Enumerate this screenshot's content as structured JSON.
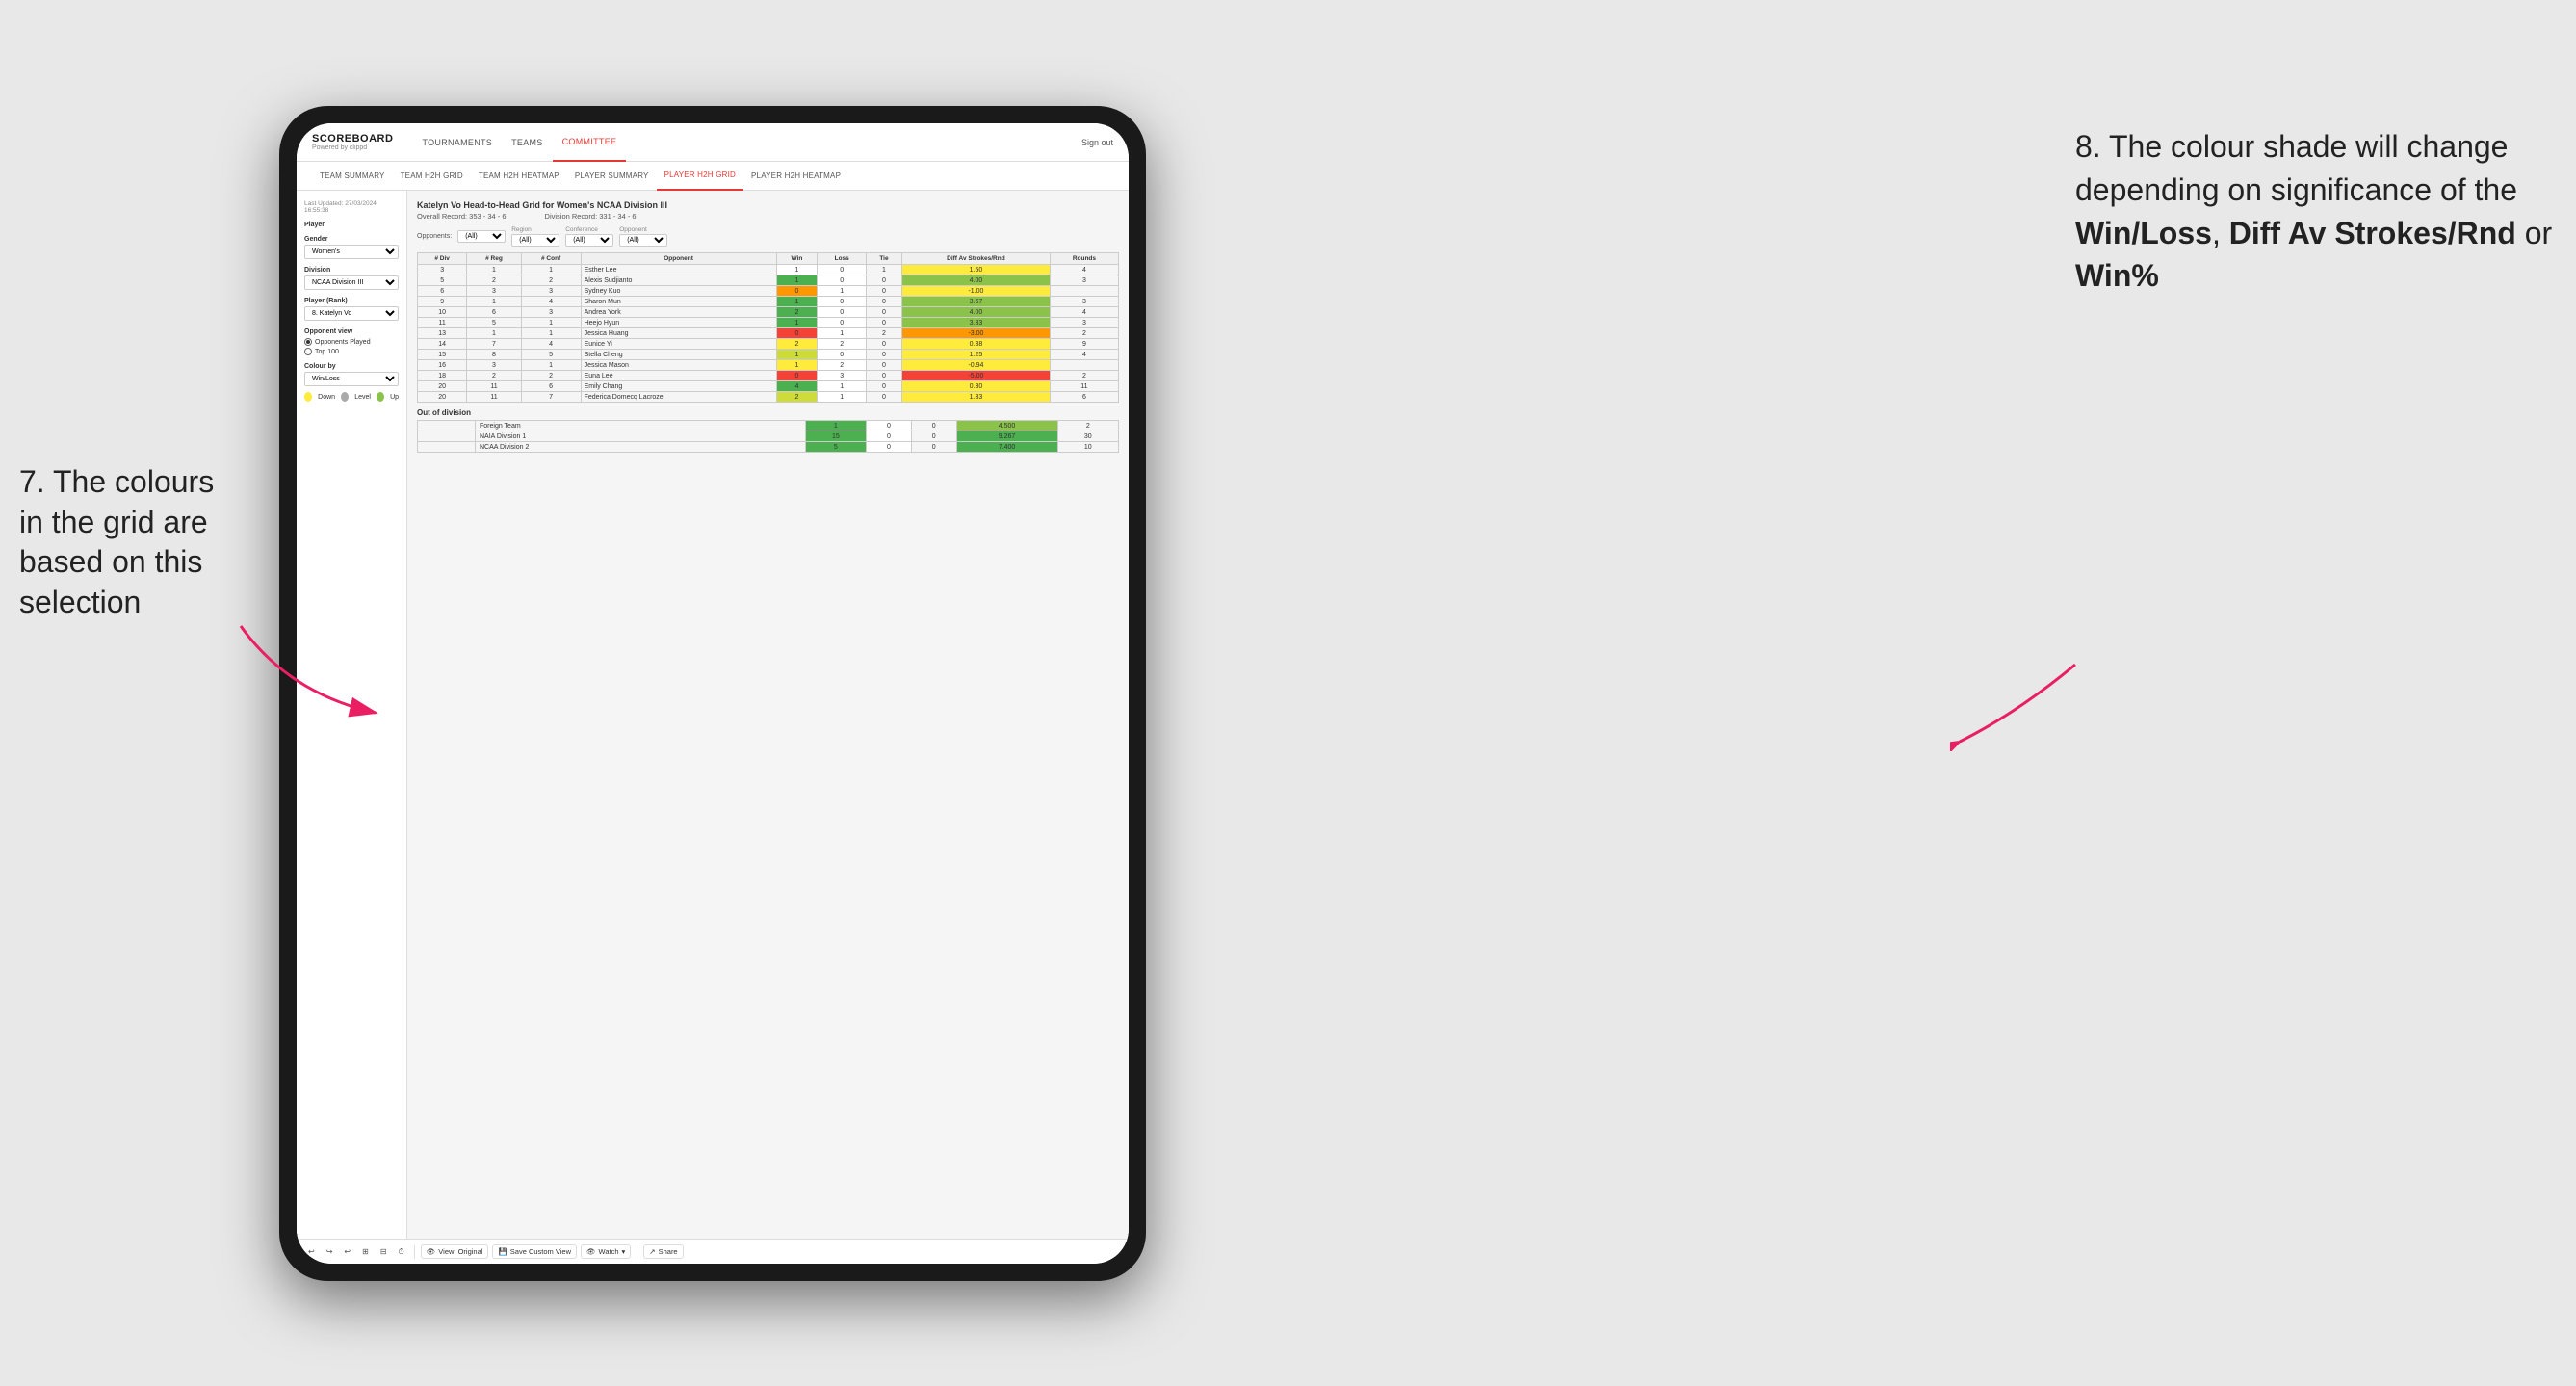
{
  "annotations": {
    "left_title": "7. The colours in the grid are based on this selection",
    "right_title": "8. The colour shade will change depending on significance of the",
    "right_bold1": "Win/Loss",
    "right_bold2": "Diff Av Strokes/Rnd",
    "right_bold3": "Win%",
    "right_suffix": "or"
  },
  "nav": {
    "logo": "SCOREBOARD",
    "logo_sub": "Powered by clippd",
    "items": [
      "TOURNAMENTS",
      "TEAMS",
      "COMMITTEE"
    ],
    "active": "COMMITTEE",
    "sign_out": "Sign out"
  },
  "sub_nav": {
    "items": [
      "TEAM SUMMARY",
      "TEAM H2H GRID",
      "TEAM H2H HEATMAP",
      "PLAYER SUMMARY",
      "PLAYER H2H GRID",
      "PLAYER H2H HEATMAP"
    ],
    "active": "PLAYER H2H GRID"
  },
  "sidebar": {
    "timestamp": "Last Updated: 27/03/2024 16:55:38",
    "player_section": "Player",
    "gender_label": "Gender",
    "gender_value": "Women's",
    "division_label": "Division",
    "division_value": "NCAA Division III",
    "player_rank_label": "Player (Rank)",
    "player_rank_value": "8. Katelyn Vo",
    "opponent_view_label": "Opponent view",
    "opponents_played": "Opponents Played",
    "top_100": "Top 100",
    "colour_by_label": "Colour by",
    "colour_by_value": "Win/Loss",
    "legend": {
      "down_color": "#ffeb3b",
      "level_color": "#aaaaaa",
      "up_color": "#8bc34a",
      "down_label": "Down",
      "level_label": "Level",
      "up_label": "Up"
    }
  },
  "grid": {
    "title": "Katelyn Vo Head-to-Head Grid for Women's NCAA Division III",
    "overall_record": "Overall Record: 353 - 34 - 6",
    "division_record": "Division Record: 331 - 34 - 6",
    "filters": {
      "opponents_label": "Opponents:",
      "opponents_value": "(All)",
      "region_label": "Region",
      "region_value": "(All)",
      "conference_label": "Conference",
      "conference_value": "(All)",
      "opponent_label": "Opponent",
      "opponent_value": "(All)"
    },
    "table_headers": [
      "# Div",
      "# Reg",
      "# Conf",
      "Opponent",
      "Win",
      "Loss",
      "Tie",
      "Diff Av Strokes/Rnd",
      "Rounds"
    ],
    "rows": [
      {
        "div": 3,
        "reg": 1,
        "conf": 1,
        "opponent": "Esther Lee",
        "win": 1,
        "loss": 0,
        "tie": 1,
        "diff": 1.5,
        "rounds": 4,
        "win_color": "white",
        "diff_color": "yellow"
      },
      {
        "div": 5,
        "reg": 2,
        "conf": 2,
        "opponent": "Alexis Sudjianto",
        "win": 1,
        "loss": 0,
        "tie": 0,
        "diff": 4.0,
        "rounds": 3,
        "win_color": "green-dark",
        "diff_color": "green-mid"
      },
      {
        "div": 6,
        "reg": 3,
        "conf": 3,
        "opponent": "Sydney Kuo",
        "win": 0,
        "loss": 1,
        "tie": 0,
        "diff": -1.0,
        "rounds": "",
        "win_color": "red-light",
        "diff_color": "yellow"
      },
      {
        "div": 9,
        "reg": 1,
        "conf": 4,
        "opponent": "Sharon Mun",
        "win": 1,
        "loss": 0,
        "tie": 0,
        "diff": 3.67,
        "rounds": 3,
        "win_color": "green-dark",
        "diff_color": "green-mid"
      },
      {
        "div": 10,
        "reg": 6,
        "conf": 3,
        "opponent": "Andrea York",
        "win": 2,
        "loss": 0,
        "tie": 0,
        "diff": 4.0,
        "rounds": 4,
        "win_color": "green-dark",
        "diff_color": "green-mid"
      },
      {
        "div": 11,
        "reg": 5,
        "conf": 1,
        "opponent": "Heejo Hyun",
        "win": 1,
        "loss": 0,
        "tie": 0,
        "diff": 3.33,
        "rounds": 3,
        "win_color": "green-dark",
        "diff_color": "green-mid"
      },
      {
        "div": 13,
        "reg": 1,
        "conf": 1,
        "opponent": "Jessica Huang",
        "win": 0,
        "loss": 1,
        "tie": 2,
        "diff": -3.0,
        "rounds": 2,
        "win_color": "red-mid",
        "diff_color": "red-light"
      },
      {
        "div": 14,
        "reg": 7,
        "conf": 4,
        "opponent": "Eunice Yi",
        "win": 2,
        "loss": 2,
        "tie": 0,
        "diff": 0.38,
        "rounds": 9,
        "win_color": "yellow",
        "diff_color": "yellow"
      },
      {
        "div": 15,
        "reg": 8,
        "conf": 5,
        "opponent": "Stella Cheng",
        "win": 1,
        "loss": 0,
        "tie": 0,
        "diff": 1.25,
        "rounds": 4,
        "win_color": "green-light",
        "diff_color": "yellow"
      },
      {
        "div": 16,
        "reg": 3,
        "conf": 1,
        "opponent": "Jessica Mason",
        "win": 1,
        "loss": 2,
        "tie": 0,
        "diff": -0.94,
        "rounds": "",
        "win_color": "yellow",
        "diff_color": "yellow"
      },
      {
        "div": 18,
        "reg": 2,
        "conf": 2,
        "opponent": "Euna Lee",
        "win": 0,
        "loss": 3,
        "tie": 0,
        "diff": -5.0,
        "rounds": 2,
        "win_color": "red-mid",
        "diff_color": "red-mid"
      },
      {
        "div": 20,
        "reg": 11,
        "conf": 6,
        "opponent": "Emily Chang",
        "win": 4,
        "loss": 1,
        "tie": 0,
        "diff": 0.3,
        "rounds": 11,
        "win_color": "green-dark",
        "diff_color": "yellow"
      },
      {
        "div": 20,
        "reg": 11,
        "conf": 7,
        "opponent": "Federica Domecq Lacroze",
        "win": 2,
        "loss": 1,
        "tie": 0,
        "diff": 1.33,
        "rounds": 6,
        "win_color": "green-light",
        "diff_color": "yellow"
      }
    ],
    "out_of_division_label": "Out of division",
    "out_of_division_rows": [
      {
        "name": "Foreign Team",
        "win": 1,
        "loss": 0,
        "tie": 0,
        "diff": 4.5,
        "rounds": 2,
        "win_color": "green-dark",
        "diff_color": "green-mid"
      },
      {
        "name": "NAIA Division 1",
        "win": 15,
        "loss": 0,
        "tie": 0,
        "diff": 9.267,
        "rounds": 30,
        "win_color": "green-dark",
        "diff_color": "green-dark"
      },
      {
        "name": "NCAA Division 2",
        "win": 5,
        "loss": 0,
        "tie": 0,
        "diff": 7.4,
        "rounds": 10,
        "win_color": "green-dark",
        "diff_color": "green-dark"
      }
    ]
  },
  "toolbar": {
    "view_original": "View: Original",
    "save_custom": "Save Custom View",
    "watch": "Watch",
    "share": "Share"
  }
}
